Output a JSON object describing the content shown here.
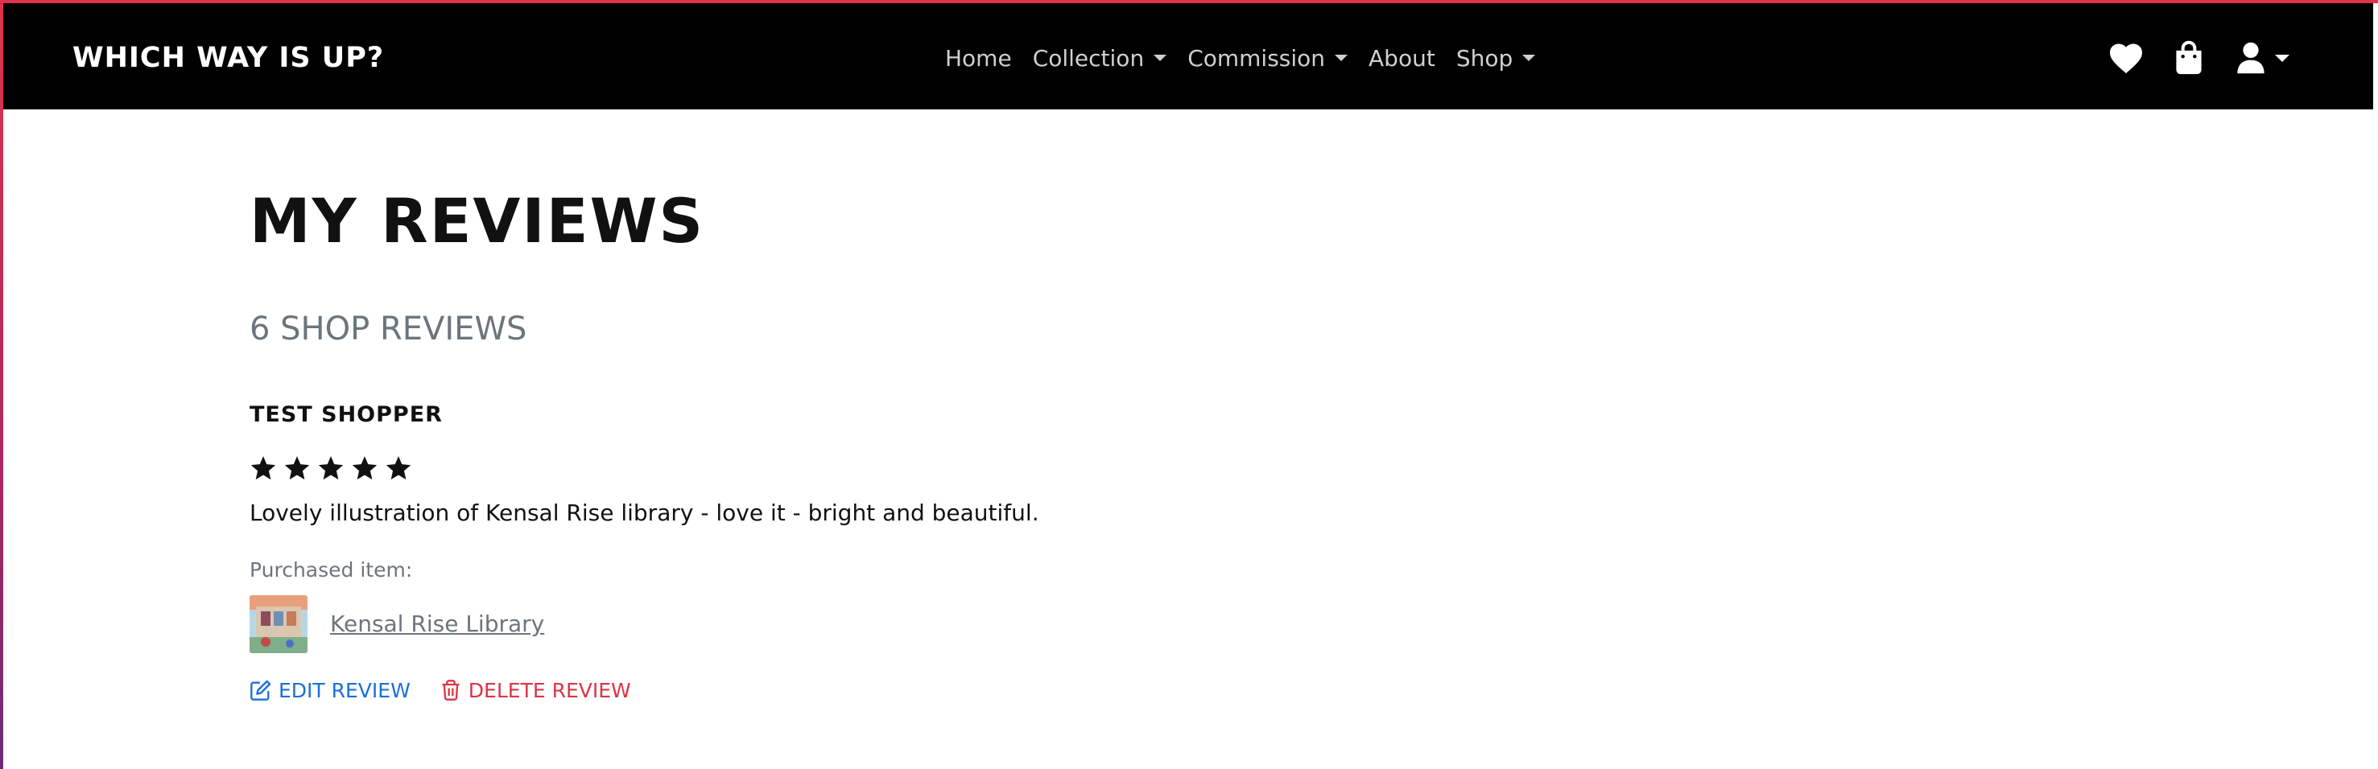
{
  "brand": {
    "name": "Which Way Is Up?"
  },
  "nav": {
    "items": [
      {
        "label": "Home",
        "has_dropdown": false
      },
      {
        "label": "Collection",
        "has_dropdown": true
      },
      {
        "label": "Commission",
        "has_dropdown": true
      },
      {
        "label": "About",
        "has_dropdown": false
      },
      {
        "label": "Shop",
        "has_dropdown": true
      }
    ],
    "icons": [
      "heart-icon",
      "shopping-bag-icon",
      "user-icon"
    ]
  },
  "page": {
    "title": "My Reviews",
    "count_label": "6 SHOP REVIEWS"
  },
  "review": {
    "reviewer": "Test Shopper",
    "rating": 5,
    "max_rating": 5,
    "text": "Lovely illustration of Kensal Rise library - love it - bright and beautiful.",
    "purchased_label": "Purchased item:",
    "product_name": "Kensal Rise Library",
    "edit_label": "EDIT REVIEW",
    "delete_label": "DELETE REVIEW"
  },
  "colors": {
    "navbar_bg": "#000000",
    "nav_text": "#cfcfcf",
    "muted": "#6c757d",
    "edit": "#1a6fdb",
    "delete": "#dc3545",
    "star": "#111111"
  }
}
